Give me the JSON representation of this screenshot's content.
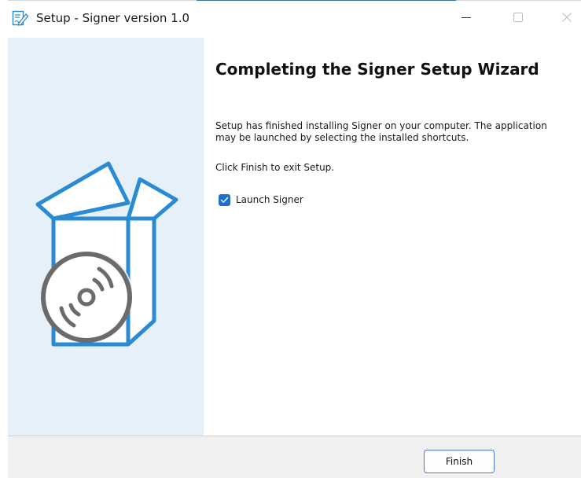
{
  "window": {
    "title": "Setup - Signer version 1.0",
    "controls": {
      "minimize_icon": "minimize-icon",
      "maximize_icon": "maximize-icon",
      "close_icon": "close-icon"
    }
  },
  "wizard": {
    "heading": "Completing the Signer Setup Wizard",
    "paragraph1": "Setup has finished installing Signer on your computer. The application may be launched by selecting the installed shortcuts.",
    "paragraph2": "Click Finish to exit Setup.",
    "launch_checkbox": {
      "label": "Launch Signer",
      "checked": true
    }
  },
  "footer": {
    "finish_label": "Finish"
  },
  "colors": {
    "side_panel": "#e6f0f8",
    "accent": "#1f6fd1",
    "box_outline": "#2a8ad4",
    "disc": "#6b6b6b"
  }
}
